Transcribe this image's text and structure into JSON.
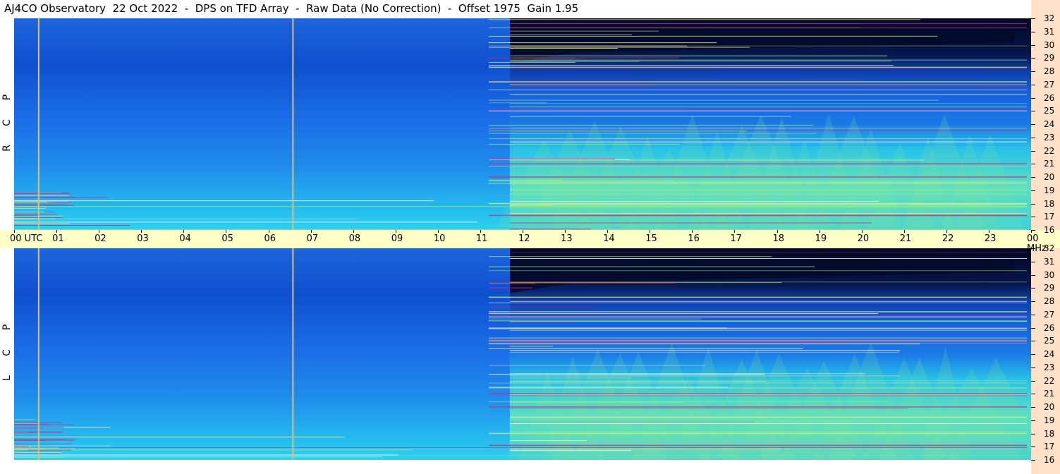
{
  "title": "AJ4CO Observatory  22 Oct 2022  -  DPS on TFD Array  -  Raw Data (No Correction)  -  Offset 1975  Gain 1.95",
  "panels": [
    {
      "name": "rcp",
      "letters": [
        "R",
        "C",
        "P"
      ]
    },
    {
      "name": "lcp",
      "letters": [
        "L",
        "C",
        "P"
      ]
    }
  ],
  "time_axis": {
    "labels": [
      "00  UTC",
      "01",
      "02",
      "03",
      "04",
      "05",
      "06",
      "07",
      "08",
      "09",
      "10",
      "11",
      "12",
      "13",
      "14",
      "15",
      "16",
      "17",
      "18",
      "19",
      "20",
      "21",
      "22",
      "23",
      "00 MHz"
    ]
  },
  "freq_axis": {
    "labels": [
      "32",
      "31",
      "30",
      "29",
      "28",
      "27",
      "26",
      "25",
      "24",
      "23",
      "22",
      "21",
      "20",
      "19",
      "18",
      "17",
      "16"
    ],
    "unit": "MHz"
  },
  "colors": {
    "quiet_band": "#1a5ee6",
    "night_noise": "#2bd0ee",
    "day_high_freq": "#030a2a",
    "interference_yellow": "#e6f06a",
    "interference_magenta": "#c8288c",
    "marker_line": "#d7c27a",
    "time_bar_bg": "#ffffc8",
    "freq_strip_bg": "#ffe0c8"
  },
  "chart_data": {
    "type": "heatmap",
    "title": "AJ4CO Observatory  22 Oct 2022  -  DPS on TFD Array  -  Raw Data (No Correction)  -  Offset 1975  Gain 1.95",
    "x_range_utc_hours": [
      0,
      24
    ],
    "y_range_mhz": [
      16,
      32
    ],
    "panels": [
      "RCP",
      "LCP"
    ],
    "x_ticks": [
      "00",
      "01",
      "02",
      "03",
      "04",
      "05",
      "06",
      "07",
      "08",
      "09",
      "10",
      "11",
      "12",
      "13",
      "14",
      "15",
      "16",
      "17",
      "18",
      "19",
      "20",
      "21",
      "22",
      "23",
      "00"
    ],
    "y_ticks": [
      16,
      17,
      18,
      19,
      20,
      21,
      22,
      23,
      24,
      25,
      26,
      27,
      28,
      29,
      30,
      31,
      32
    ],
    "vertical_markers_utc_hours": [
      0.58,
      6.58
    ]
  }
}
